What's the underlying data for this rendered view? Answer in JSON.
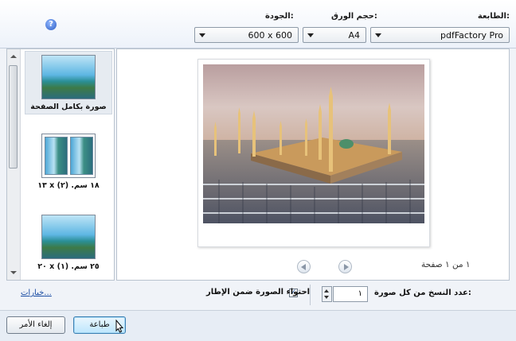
{
  "header": {
    "printer_label": "الطابعة:",
    "printer_value": "pdfFactory Pro",
    "paper_size_label": "حجم الورق:",
    "paper_size_value": "A4",
    "quality_label": "الجودة:",
    "quality_value": "600 x 600",
    "help_icon": "?"
  },
  "layouts": [
    {
      "caption": "صورة بكامل الصفحة",
      "selected": true,
      "icon": "landscape-thumb-icon"
    },
    {
      "caption": "١٣ x ١٨ سم. (٢)",
      "selected": false,
      "icon": "two-up-thumb-icon"
    },
    {
      "caption": "٢٠ x ٢٥ سم. (١)",
      "selected": false,
      "icon": "landscape-thumb-icon"
    }
  ],
  "preview": {
    "page_info": "١ من ١ صفحة",
    "image": "mosque-photo"
  },
  "options": {
    "options_link": "خيارات...",
    "fit_picture_label": "احتواء الصورة ضمن الإطار",
    "fit_picture_checked": true,
    "copies_label": "عدد النسخ من كل صورة:",
    "copies_value": "١"
  },
  "footer": {
    "print_button": "طباعة",
    "cancel_button": "إلغاء الأمر"
  },
  "colors": {
    "accent": "#3c7fb1",
    "link": "#1a4ca3"
  }
}
